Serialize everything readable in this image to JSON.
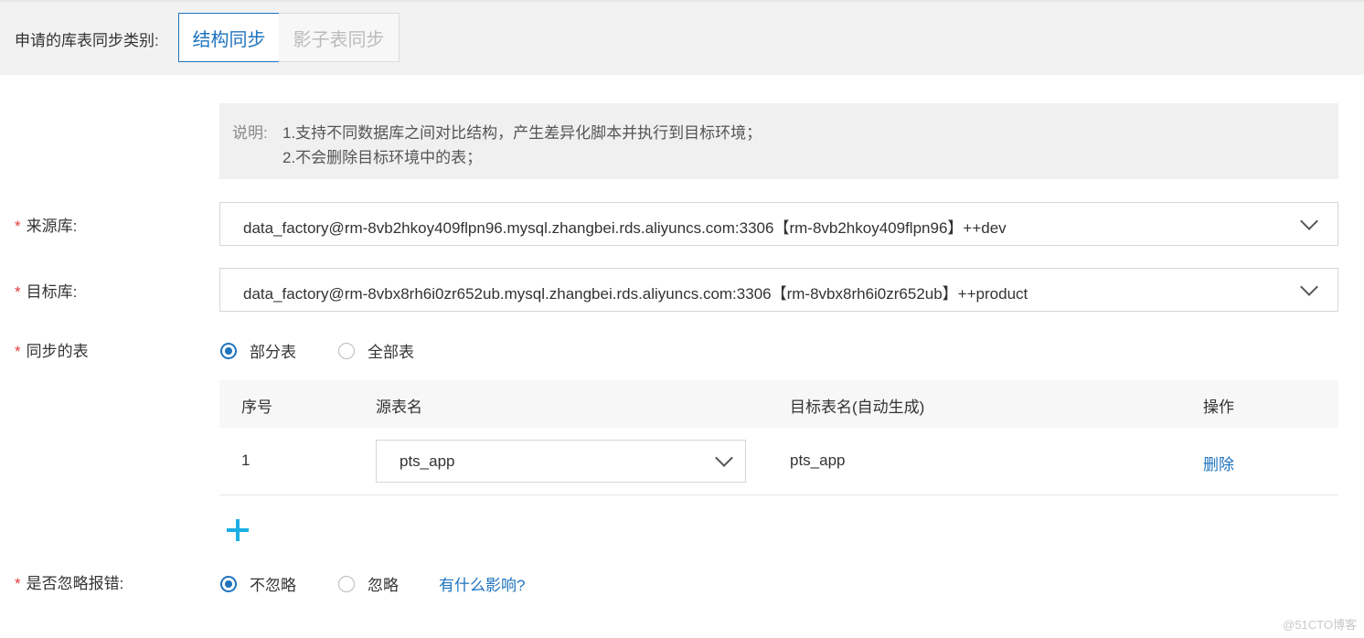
{
  "header": {
    "category_label": "申请的库表同步类别:",
    "tabs": [
      {
        "label": "结构同步",
        "active": true
      },
      {
        "label": "影子表同步",
        "active": false
      }
    ]
  },
  "note": {
    "prefix": "说明:",
    "line1": "1.支持不同数据库之间对比结构，产生差异化脚本并执行到目标环境；",
    "line2": "2.不会删除目标环境中的表；"
  },
  "form": {
    "required_mark": "*",
    "source_db": {
      "label": "来源库:",
      "value": "data_factory@rm-8vb2hkoy409flpn96.mysql.zhangbei.rds.aliyuncs.com:3306【rm-8vb2hkoy409flpn96】++dev"
    },
    "target_db": {
      "label": "目标库:",
      "value": "data_factory@rm-8vbx8rh6i0zr652ub.mysql.zhangbei.rds.aliyuncs.com:3306【rm-8vbx8rh6i0zr652ub】++product"
    },
    "sync_tables": {
      "label": "同步的表",
      "options": [
        {
          "label": "部分表",
          "selected": true
        },
        {
          "label": "全部表",
          "selected": false
        }
      ]
    },
    "table": {
      "columns": [
        "序号",
        "源表名",
        "目标表名(自动生成)",
        "操作"
      ],
      "rows": [
        {
          "index": "1",
          "source": "pts_app",
          "target": "pts_app",
          "action": "删除"
        }
      ]
    },
    "ignore_errors": {
      "label": "是否忽略报错:",
      "options": [
        {
          "label": "不忽略",
          "selected": true
        },
        {
          "label": "忽略",
          "selected": false
        }
      ],
      "help_link": "有什么影响?"
    }
  },
  "watermark": "@51CTO博客",
  "colors": {
    "accent": "#1e73be",
    "required": "#e03c3c",
    "plus": "#1aaee5"
  }
}
